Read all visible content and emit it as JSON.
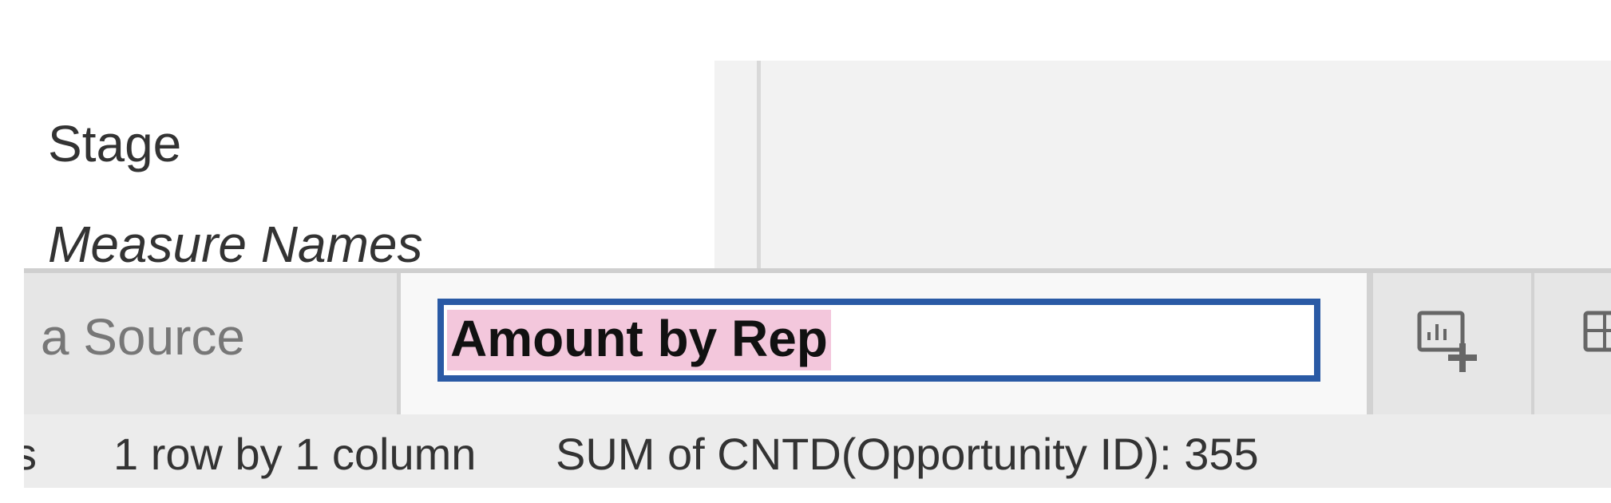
{
  "marks_card": {
    "fields": [
      {
        "label": "Stage"
      },
      {
        "label": "Measure Names"
      }
    ]
  },
  "tabs": {
    "data_source_label": "a Source",
    "active_sheet_name_value": "Amount by Rep",
    "new_worksheet_icon": "new-worksheet-icon",
    "new_dashboard_icon": "new-dashboard-icon"
  },
  "status_bar": {
    "marks_fragment": "ks",
    "dimensions": "1 row by 1 column",
    "summary": "SUM of CNTD(Opportunity ID): 355"
  },
  "colors": {
    "input_border": "#2a5aa5",
    "selection_highlight": "#f3c7dc",
    "tab_bar_bg": "#e6e6e6",
    "view_bg": "#f2f2f2"
  }
}
